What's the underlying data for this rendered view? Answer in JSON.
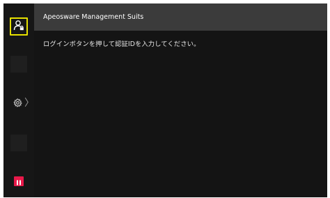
{
  "header": {
    "title": "Apeosware Management Suits"
  },
  "main": {
    "instruction": "ログインボタンを押して認証IDを入力してください。"
  },
  "sidebar": {
    "login_icon": "user-lock-icon",
    "settings_icon": "gear-icon",
    "settings_chevron": "〉",
    "pause_icon": "pause-icon"
  },
  "colors": {
    "highlight_border": "#e6e000",
    "pause_accent": "#e8194a",
    "header_bg": "#3b3b3b",
    "panel_bg": "#141414"
  }
}
